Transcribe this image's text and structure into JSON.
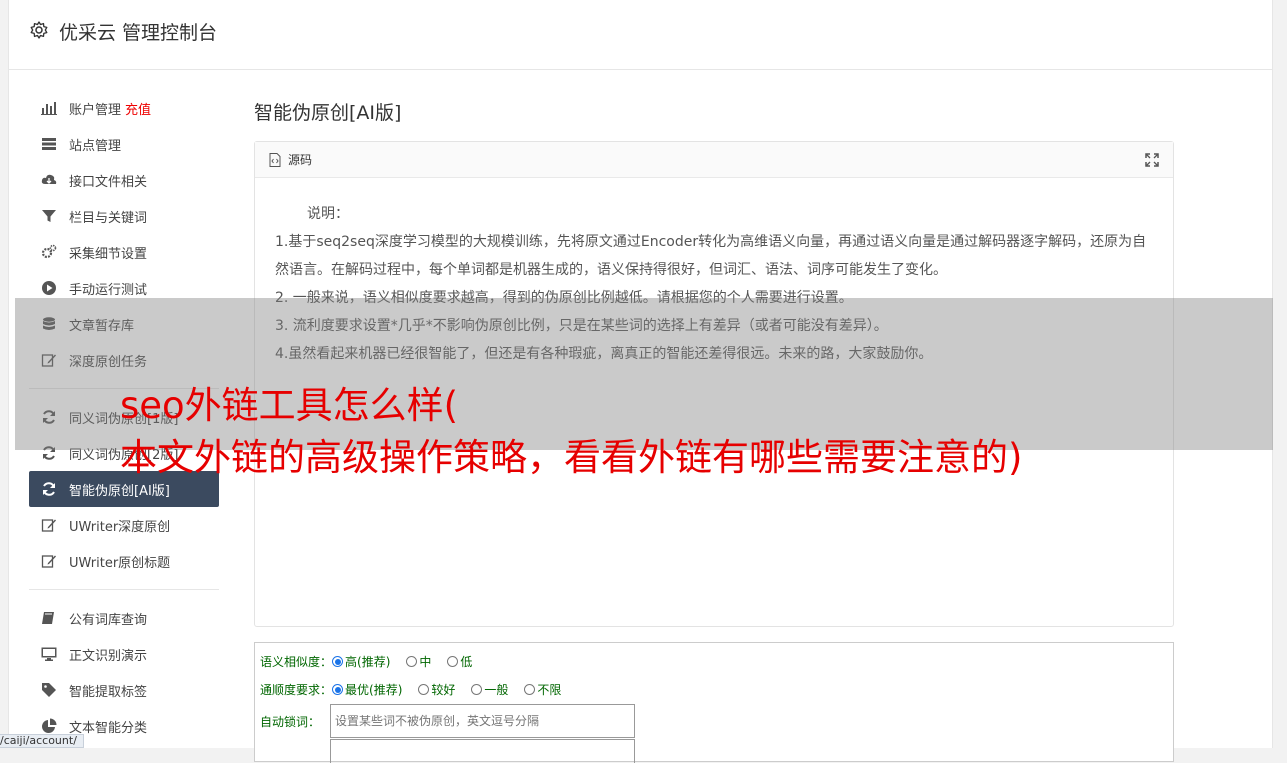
{
  "header": {
    "title": "优采云 管理控制台"
  },
  "sidebar": {
    "account": {
      "label": "账户管理",
      "badge": "充值"
    },
    "items": [
      {
        "label": "站点管理"
      },
      {
        "label": "接口文件相关"
      },
      {
        "label": "栏目与关键词"
      },
      {
        "label": "采集细节设置"
      },
      {
        "label": "手动运行测试"
      },
      {
        "label": "文章暂存库"
      },
      {
        "label": "深度原创任务"
      }
    ],
    "group2": [
      {
        "label": "同义词伪原创[1版]"
      },
      {
        "label": "同义词伪原创[2版]"
      },
      {
        "label": "智能伪原创[AI版]"
      },
      {
        "label": "UWriter深度原创"
      },
      {
        "label": "UWriter原创标题"
      }
    ],
    "group3": [
      {
        "label": "公有词库查询"
      },
      {
        "label": "正文识别演示"
      },
      {
        "label": "智能提取标签"
      },
      {
        "label": "文本智能分类"
      }
    ]
  },
  "main": {
    "title": "智能伪原创[AI版]",
    "panel": {
      "title": "源码",
      "intro": "说明：",
      "lines": [
        "1.基于seq2seq深度学习模型的大规模训练，先将原文通过Encoder转化为高维语义向量，再通过语义向量是通过解码器逐字解码，还原为自然语言。在解码过程中，每个单词都是机器生成的，语义保持得很好，但词汇、语法、词序可能发生了变化。",
        "2. 一般来说，语义相似度要求越高，得到的伪原创比例越低。请根据您的个人需要进行设置。",
        "3. 流利度要求设置*几乎*不影响伪原创比例，只是在某些词的选择上有差异（或者可能没有差异）。",
        "4.虽然看起来机器已经很智能了，但还是有各种瑕疵，离真正的智能还差得很远。未来的路，大家鼓励你。"
      ]
    },
    "form": {
      "similarity": {
        "label": "语义相似度：",
        "options": [
          "高(推荐)",
          "中",
          "低"
        ]
      },
      "fluency": {
        "label": "通顺度要求：",
        "options": [
          "最优(推荐)",
          "较好",
          "一般",
          "不限"
        ]
      },
      "lock": {
        "label": "自动锁词：",
        "placeholder": "设置某些词不被伪原创，英文逗号分隔"
      }
    }
  },
  "watermark": {
    "line1": "seo外链工具怎么样(",
    "line2": "本文外链的高级操作策略，看看外链有哪些需要注意的)"
  },
  "status": {
    "url": "/caiji/account/"
  }
}
